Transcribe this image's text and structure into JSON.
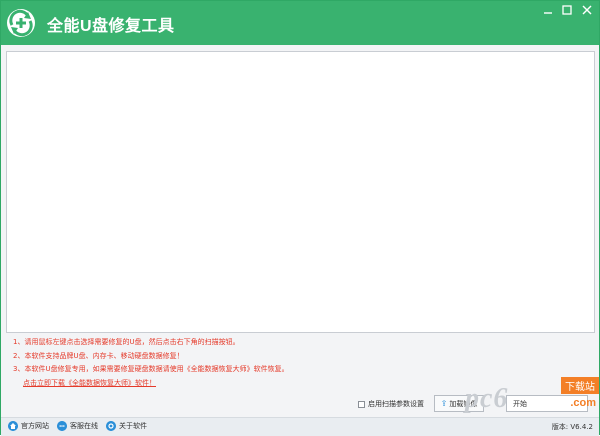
{
  "window": {
    "title": "全能U盘修复工具",
    "accent_color": "#39b26f"
  },
  "titlebar_buttons": {
    "minimize_icon": "minimize-icon",
    "maximize_icon": "maximize-icon",
    "close_icon": "close-icon"
  },
  "notes": {
    "line1": "1、请用鼠标左键点击选择需要修复的U盘，然后点击右下角的扫描按钮。",
    "line2": "2、本软件支持品牌U盘、内存卡、移动硬盘数据修复！",
    "line3": "3、本软件U盘修复专用，如果需要修复硬盘数据请使用《全能数据恢复大师》软件恢复。",
    "link": "点击立即下载《全能数据恢复大师》软件！",
    "color": "#e53a2a"
  },
  "controls": {
    "scan_params_label": "启用扫描参数设置",
    "scan_params_checked": false,
    "load_image_label": "加载镜像",
    "start_label": "开始"
  },
  "watermark": {
    "badge": "下载站",
    "logo": "pc6",
    "domain": ".com"
  },
  "statusbar": {
    "official_site": "官方网站",
    "customer_service": "客服在线",
    "about": "关于软件",
    "version": "版本: V6.4.2"
  }
}
